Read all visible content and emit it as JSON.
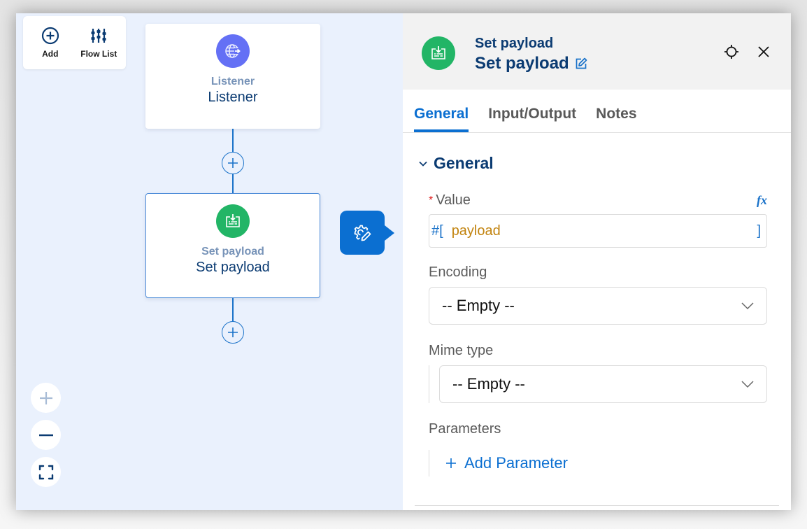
{
  "toolbar": {
    "add_label": "Add",
    "flow_list_label": "Flow List"
  },
  "canvas": {
    "nodes": [
      {
        "type": "Listener",
        "name": "Listener",
        "icon": "globe-arrow-icon",
        "color": "#6470f5"
      },
      {
        "type": "Set payload",
        "name": "Set payload",
        "icon": "set-payload-icon",
        "color": "#22b566",
        "selected": true
      }
    ],
    "zoom_controls": [
      "zoom-in",
      "zoom-out",
      "fit-to-screen"
    ]
  },
  "panel": {
    "header": {
      "type": "Set payload",
      "name": "Set payload"
    },
    "tabs": [
      {
        "label": "General",
        "active": true
      },
      {
        "label": "Input/Output",
        "active": false
      },
      {
        "label": "Notes",
        "active": false
      }
    ],
    "section_title": "General",
    "value": {
      "label": "Value",
      "required_mark": "*",
      "fx_label": "fx",
      "expr_open": "#[",
      "expr_body": "payload",
      "expr_close": "]"
    },
    "encoding": {
      "label": "Encoding",
      "selected": "-- Empty --"
    },
    "mime_type": {
      "label": "Mime type",
      "selected": "-- Empty --"
    },
    "parameters": {
      "label": "Parameters",
      "add_label": "Add Parameter"
    }
  },
  "colors": {
    "accent": "#0b6fd1",
    "navy": "#0b3b72",
    "success_green": "#22b566",
    "listener_purple": "#6470f5",
    "expression_orange": "#c28410",
    "canvas_bg": "#eaf1fd"
  }
}
